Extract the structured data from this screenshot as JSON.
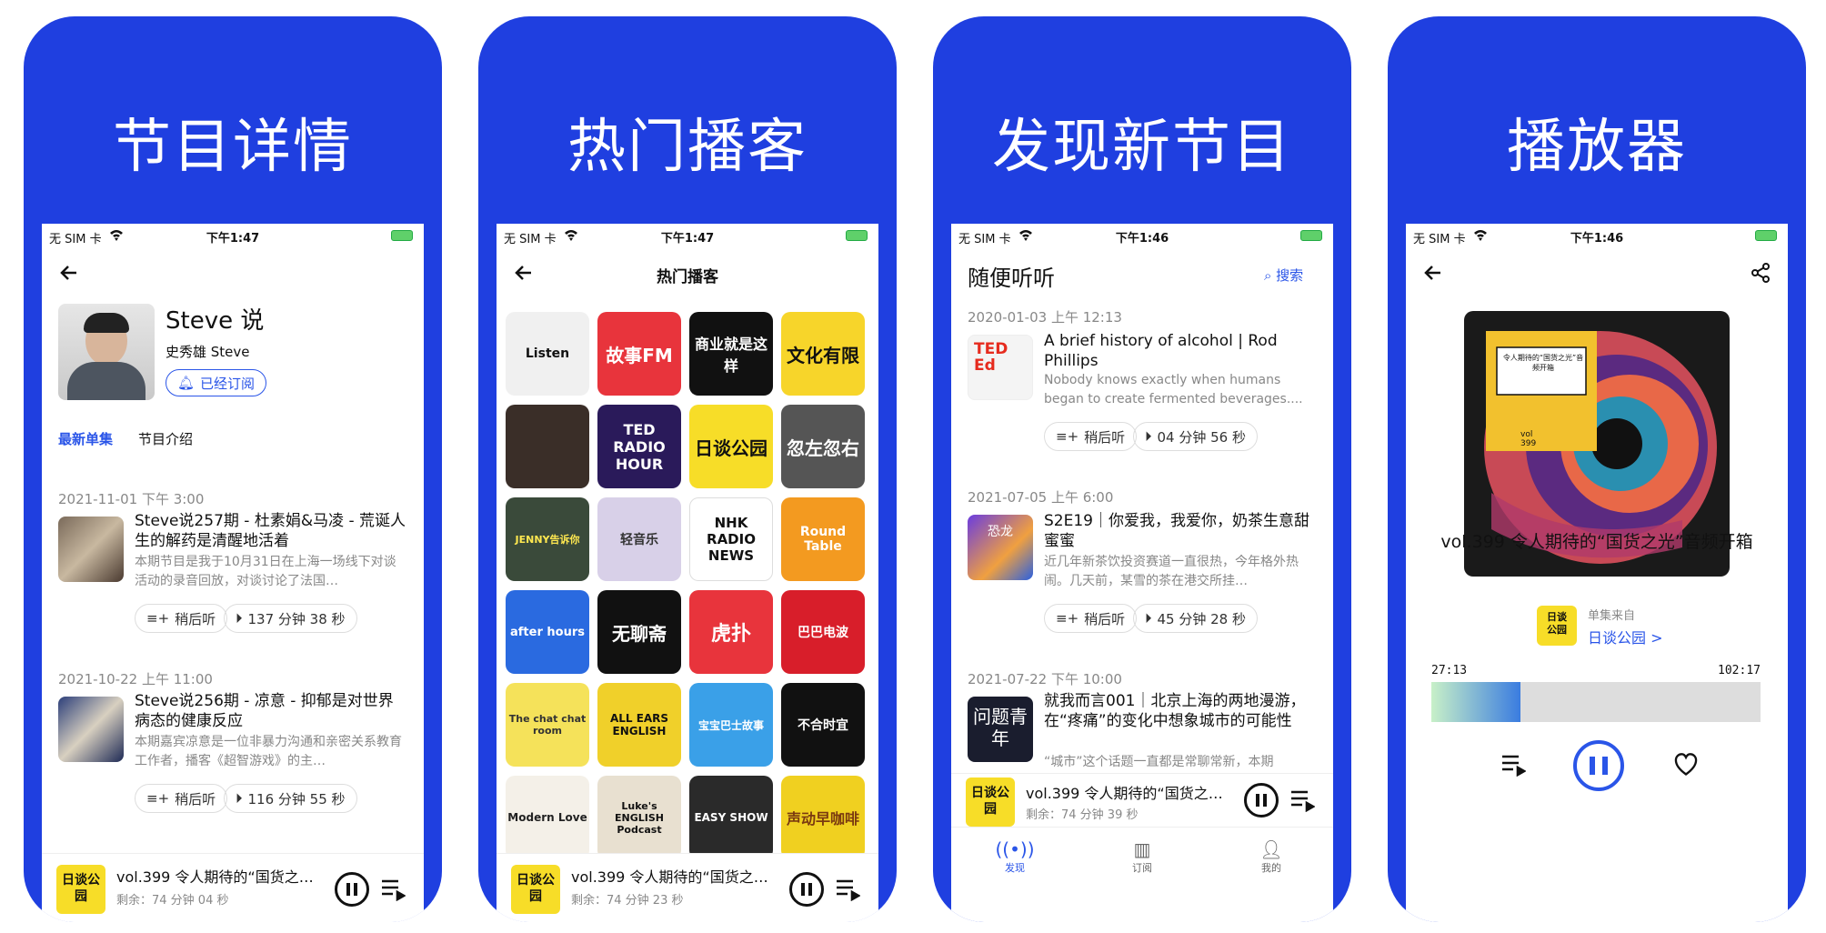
{
  "colors": {
    "brand_blue": "#1f3fe0",
    "link_blue": "#2a55e8",
    "yellow": "#f7dd28"
  },
  "status": {
    "carrier": "无 SIM 卡",
    "time_1": "下午1:47",
    "time_2": "下午1:47",
    "time_3": "下午1:46",
    "time_4": "下午1:46"
  },
  "panel1": {
    "title": "节目详情",
    "show_name": "Steve 说",
    "host": "史秀雄 Steve",
    "subscribed": "已经订阅",
    "tabs": [
      "最新单集",
      "节目介绍"
    ],
    "episodes": [
      {
        "date": "2021-11-01 下午 3:00",
        "title": "Steve说257期 - 杜素娟&马凌 - 荒诞人生的解药是清醒地活着",
        "desc": "本期节目是我于10月31日在上海一场线下对谈活动的录音回放，对谈讨论了法国…",
        "later": "稍后听",
        "duration": "137 分钟 38 秒"
      },
      {
        "date": "2021-10-22 上午 11:00",
        "title": "Steve说256期 - 凉意 - 抑郁是对世界病态的健康反应",
        "desc": "本期嘉宾凉意是一位非暴力沟通和亲密关系教育工作者，播客《超智游戏》的主…",
        "later": "稍后听",
        "duration": "116 分钟 55 秒"
      }
    ],
    "mini": {
      "art": "日谈公园",
      "title": "vol.399 令人期待的“国货之…",
      "remaining": "剩余：74 分钟 04 秒"
    }
  },
  "panel2": {
    "title": "热门播客",
    "header": "热门播客",
    "tiles": [
      "Listen",
      "故事FM",
      "商业就是这样",
      "文化有限",
      "",
      "TED RADIO HOUR",
      "日谈公园",
      "忽左忽右",
      "JENNY告诉你",
      "轻音乐",
      "NHK RADIO NEWS",
      "Round Table",
      "after hours",
      "无聊斋",
      "虎扑",
      "巴巴电波",
      "The chat chat room",
      "ALL EARS ENGLISH",
      "宝宝巴士故事",
      "不合时宜",
      "Modern Love",
      "Luke's ENGLISH Podcast",
      "EASY SHOW",
      "声动早咖啡"
    ],
    "mini": {
      "art": "日谈公园",
      "title": "vol.399 令人期待的“国货之…",
      "remaining": "剩余：74 分钟 23 秒"
    }
  },
  "panel3": {
    "title": "发现新节目",
    "header": "随便听听",
    "search": "搜索",
    "episodes": [
      {
        "date": "2020-01-03 上午 12:13",
        "art": "TED Ed",
        "title": "A brief history of alcohol | Rod Phillips",
        "desc": "Nobody knows exactly when humans began to create fermented beverages....",
        "later": "稍后听",
        "duration": "04 分钟 56 秒"
      },
      {
        "date": "2021-07-05 上午 6:00",
        "art": "恐龙",
        "title": "S2E19｜你爱我，我爱你，奶茶生意甜蜜蜜",
        "desc": "近几年新茶饮投资赛道一直很热，今年格外热闹。几天前，某雪的茶在港交所挂…",
        "later": "稍后听",
        "duration": "45 分钟 28 秒"
      },
      {
        "date": "2021-07-22 下午 10:00",
        "art": "问题青年",
        "title": "就我而言001｜北京上海的两地漫游，在“疼痛”的变化中想象城市的可能性",
        "desc": "“城市”这个话题一直都是常聊常新，本期"
      }
    ],
    "mini": {
      "art": "日谈公园",
      "title": "vol.399 令人期待的“国货之…",
      "remaining": "剩余：74 分钟 39 秒"
    },
    "tabs": [
      "发现",
      "订阅",
      "我的"
    ]
  },
  "panel4": {
    "title": "播放器",
    "cover_text": "令人期待的“国货之光”音频开箱",
    "episode_title": "vol.399 令人期待的“国货之光”音频开箱",
    "from_label": "单集来自",
    "from_show": "日谈公园 >",
    "elapsed": "27:13",
    "total": "102:17",
    "progress": 0.27
  }
}
